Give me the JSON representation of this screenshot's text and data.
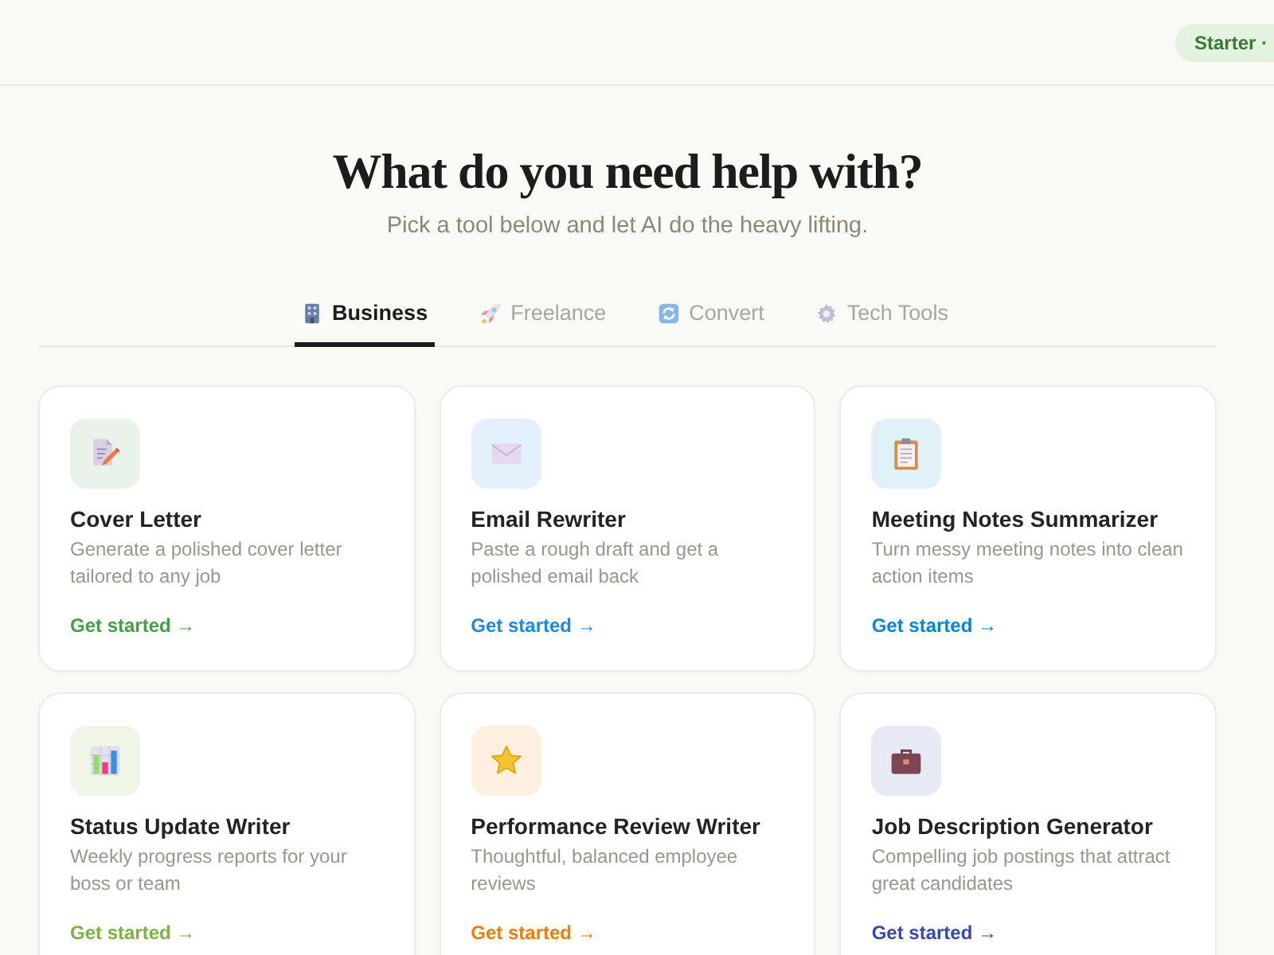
{
  "header": {
    "plan_badge": "Starter ·"
  },
  "hero": {
    "title": "What do you need help with?",
    "subtitle": "Pick a tool below and let AI do the heavy lifting."
  },
  "tabs": [
    {
      "label": "Business",
      "selected": true
    },
    {
      "label": "Freelance",
      "selected": false
    },
    {
      "label": "Convert",
      "selected": false
    },
    {
      "label": "Tech Tools",
      "selected": false
    }
  ],
  "cards": [
    {
      "title": "Cover Letter",
      "description": "Generate a polished cover letter tailored to any job",
      "link": "Get started →",
      "color": "#43a047"
    },
    {
      "title": "Email Rewriter",
      "description": "Paste a rough draft and get a polished email back",
      "link": "Get started →",
      "color": "#1e88e5"
    },
    {
      "title": "Meeting Notes Summarizer",
      "description": "Turn messy meeting notes into clean action items",
      "link": "Get started →",
      "color": "#0288d1"
    },
    {
      "title": "Status Update Writer",
      "description": "Weekly progress reports for your boss or team",
      "link": "Get started →",
      "color": "#7cb342"
    },
    {
      "title": "Performance Review Writer",
      "description": "Thoughtful, balanced employee reviews",
      "link": "Get started →",
      "color": "#f57c00"
    },
    {
      "title": "Job Description Generator",
      "description": "Compelling job postings that attract great candidates",
      "link": "Get started →",
      "color": "#3949ab"
    }
  ]
}
